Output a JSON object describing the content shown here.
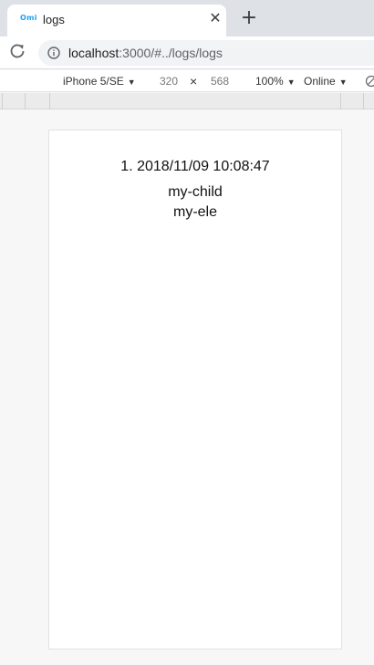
{
  "browser": {
    "tab": {
      "favicon_text": "Omi",
      "title": "logs",
      "close_glyph": "✕"
    },
    "new_tab_glyph": "+",
    "address": {
      "host": "localhost",
      "rest": ":3000/#../logs/logs"
    }
  },
  "device_toolbar": {
    "device": "iPhone 5/SE",
    "width": "320",
    "times": "×",
    "height": "568",
    "zoom": "100%",
    "network": "Online",
    "caret": "▼"
  },
  "page": {
    "log": {
      "time": "1. 2018/11/09 10:08:47",
      "lines": [
        "my-child",
        "my-ele"
      ]
    }
  }
}
